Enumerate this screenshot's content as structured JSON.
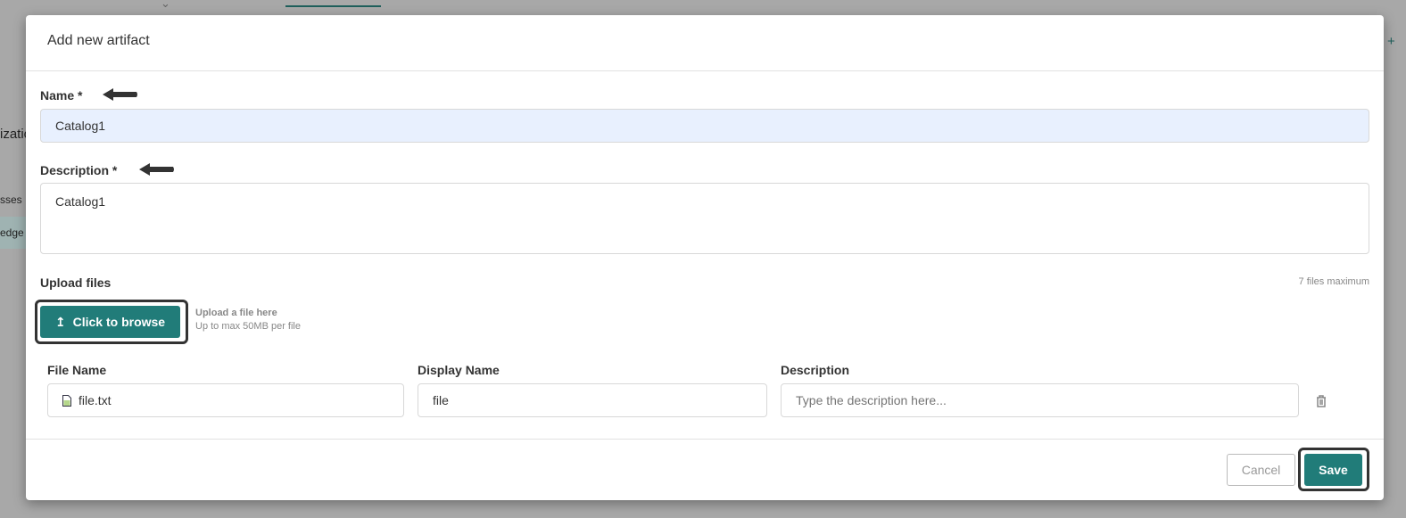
{
  "background": {
    "partial_texts": [
      "izatio",
      "sses",
      "edge"
    ],
    "plus_label": "+"
  },
  "modal": {
    "title": "Add new artifact",
    "name": {
      "label": "Name *",
      "value": "Catalog1"
    },
    "description": {
      "label": "Description *",
      "value": "Catalog1"
    },
    "upload": {
      "label": "Upload files",
      "limit": "7 files maximum",
      "button": "Click to browse",
      "hint1": "Upload a file here",
      "hint2": "Up to max 50MB per file"
    },
    "files_table": {
      "headers": [
        "File Name",
        "Display Name",
        "Description"
      ],
      "rows": [
        {
          "file_name": "file.txt",
          "display_name": "file",
          "description_placeholder": "Type the description here..."
        }
      ]
    },
    "footer": {
      "cancel": "Cancel",
      "save": "Save"
    }
  },
  "colors": {
    "accent": "#217c79",
    "name_input_bg": "#e8f0fe"
  }
}
